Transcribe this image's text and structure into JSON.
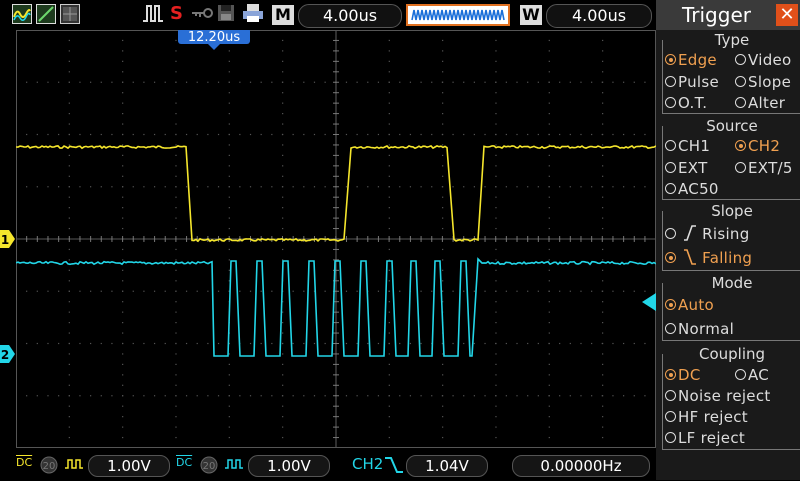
{
  "topbar": {
    "timebase": "4.00us",
    "window_timebase": "4.00us",
    "m_label": "M",
    "w_label": "W",
    "trigger_position": "12.20us",
    "s_label": "S"
  },
  "channels": {
    "ch1_color": "#f5e62c",
    "ch2_color": "#22d6e8",
    "ch1_marker": "1",
    "ch2_marker": "2"
  },
  "bottombar": {
    "ch1_coupling": "DC",
    "ch1_scale": "1.00V",
    "ch2_coupling": "DC",
    "ch2_scale": "1.00V",
    "trigger_source": "CH2",
    "trigger_level": "1.04V",
    "frequency": "0.00000Hz",
    "bw_label": "20"
  },
  "trigger_panel": {
    "title": "Trigger",
    "type": {
      "title": "Type",
      "options": [
        "Edge",
        "Video",
        "Pulse",
        "Slope",
        "O.T.",
        "Alter"
      ],
      "selected": "Edge"
    },
    "source": {
      "title": "Source",
      "options": [
        "CH1",
        "CH2",
        "EXT",
        "EXT/5",
        "AC50"
      ],
      "selected": "CH2"
    },
    "slope": {
      "title": "Slope",
      "options": [
        "Rising",
        "Falling"
      ],
      "selected": "Falling"
    },
    "mode": {
      "title": "Mode",
      "options": [
        "Auto",
        "Normal"
      ],
      "selected": "Auto"
    },
    "coupling": {
      "title": "Coupling",
      "options": [
        "DC",
        "AC",
        "Noise reject",
        "HF reject",
        "LF reject"
      ],
      "selected": "DC"
    }
  }
}
